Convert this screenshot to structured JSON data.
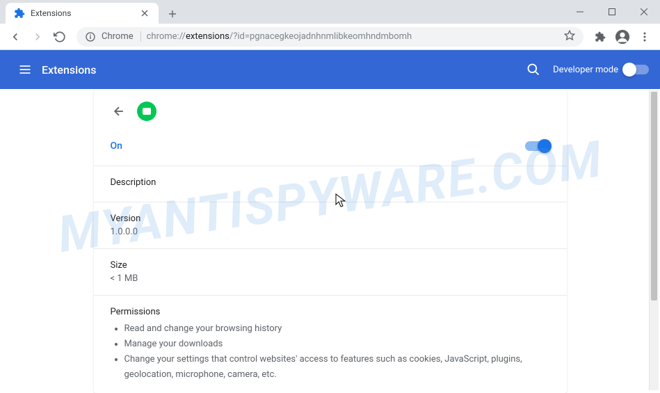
{
  "window": {
    "tab_title": "Extensions"
  },
  "toolbar": {
    "omnibox_prefix": "Chrome",
    "omnibox_url_pre": "chrome://",
    "omnibox_url_bold": "extensions",
    "omnibox_url_post": "/?id=pgnacegkeojadnhnmlibkeomhndmbomh"
  },
  "app_bar": {
    "title": "Extensions",
    "dev_mode_label": "Developer mode"
  },
  "detail": {
    "on_label": "On",
    "description_label": "Description",
    "description_value": "",
    "version_label": "Version",
    "version_value": "1.0.0.0",
    "size_label": "Size",
    "size_value": "< 1 MB",
    "permissions_label": "Permissions",
    "permissions": [
      "Read and change your browsing history",
      "Manage your downloads",
      "Change your settings that control websites' access to features such as cookies, JavaScript, plugins, geolocation, microphone, camera, etc."
    ]
  },
  "watermark": "MYANTISPYWARE.COM"
}
